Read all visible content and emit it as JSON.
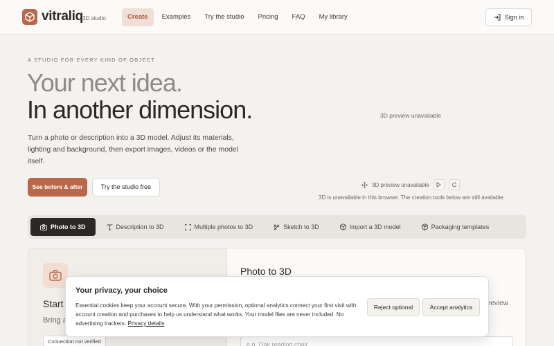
{
  "header": {
    "brand": "vitraliq",
    "brand_sub": "3D studio",
    "nav": [
      {
        "label": "Create",
        "active": true
      },
      {
        "label": "Examples"
      },
      {
        "label": "Try the studio"
      },
      {
        "label": "Pricing"
      },
      {
        "label": "FAQ"
      },
      {
        "label": "My library"
      }
    ],
    "signin_label": "Sign in",
    "accent": "#b9684a"
  },
  "hero": {
    "eyebrow": "A STUDIO FOR EVERY KIND OF OBJECT",
    "line1": "Your next idea.",
    "line2": "In another dimension.",
    "description": "Turn a photo or description into a 3D model. Adjust its materials, lighting and background, then export images, videos or the model itself.",
    "primary_button": "See before & after",
    "secondary_button": "Try the studio free"
  },
  "preview": {
    "top_label": "3D preview unavailable",
    "bar_label": "3D preview unavailable",
    "note": "3D is unavailable in this browser. The creation tools below are still available."
  },
  "tabs": [
    {
      "label": "Photo to 3D",
      "icon": "camera-icon",
      "active": true
    },
    {
      "label": "Description to 3D",
      "icon": "text-icon"
    },
    {
      "label": "Multiple photos to 3D",
      "icon": "frame-icon"
    },
    {
      "label": "Sketch to 3D",
      "icon": "sketch-icon"
    },
    {
      "label": "Import a 3D model",
      "icon": "cube-icon"
    },
    {
      "label": "Packaging templates",
      "icon": "package-icon"
    }
  ],
  "panel": {
    "start_title": "Start",
    "bring_text": "Bring a",
    "connection_badge": "Connection not verified",
    "right_title": "Photo to 3D",
    "review_text": "review",
    "input_placeholder": "e.g. Oak reading chair"
  },
  "cookie": {
    "title": "Your privacy, your choice",
    "body": "Essential cookies keep your account secure. With your permission, optional analytics connect your first visit with account creation and purchases to help us understand what works. Your model files are never included. No advertising trackers.",
    "link": "Privacy details",
    "reject_label": "Reject optional",
    "accept_label": "Accept analytics"
  }
}
